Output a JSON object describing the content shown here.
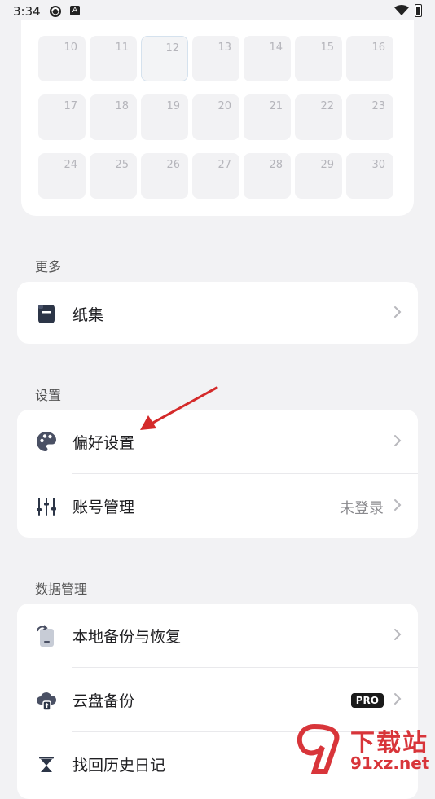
{
  "status_bar": {
    "time": "3:34",
    "notif_icon_letter": "A"
  },
  "calendar": {
    "days": [
      "10",
      "11",
      "12",
      "13",
      "14",
      "15",
      "16",
      "17",
      "18",
      "19",
      "20",
      "21",
      "22",
      "23",
      "24",
      "25",
      "26",
      "27",
      "28",
      "29",
      "30"
    ],
    "today": "12"
  },
  "sections": {
    "more": {
      "title": "更多",
      "items": [
        {
          "label": "纸集",
          "icon": "notebook-icon"
        }
      ]
    },
    "settings": {
      "title": "设置",
      "items": [
        {
          "label": "偏好设置",
          "icon": "palette-icon"
        },
        {
          "label": "账号管理",
          "icon": "sliders-icon",
          "value": "未登录"
        }
      ]
    },
    "data": {
      "title": "数据管理",
      "items": [
        {
          "label": "本地备份与恢复",
          "icon": "phone-backup-icon"
        },
        {
          "label": "云盘备份",
          "icon": "cloud-upload-icon",
          "badge": "PRO"
        },
        {
          "label": "找回历史日记",
          "icon": "hourglass-icon"
        }
      ]
    }
  },
  "watermark": {
    "brand": "下载站",
    "domain": "91xz.net"
  },
  "colors": {
    "annotation_arrow": "#d42a2a",
    "pro_badge": "#1a1a1a",
    "watermark": "#d8353a"
  }
}
